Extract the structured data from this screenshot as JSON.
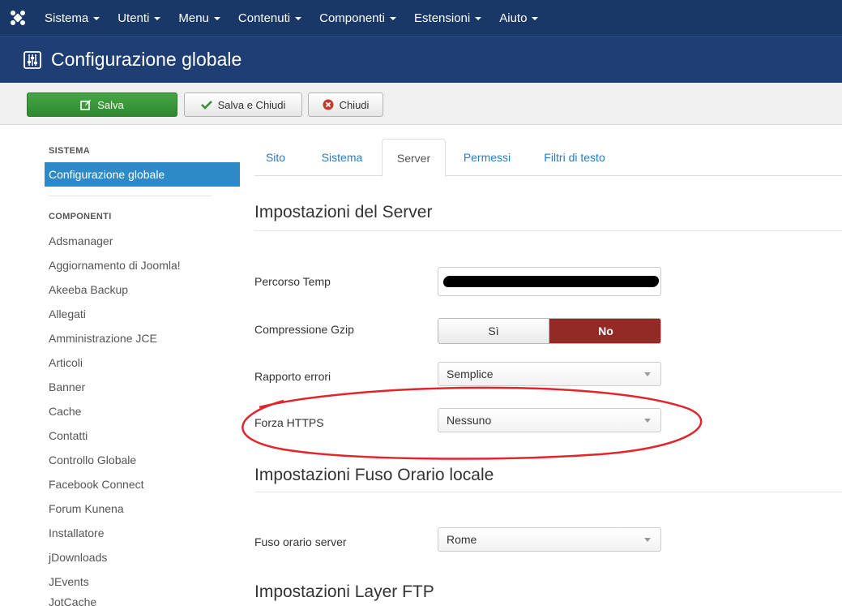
{
  "menubar": {
    "items": [
      {
        "label": "Sistema"
      },
      {
        "label": "Utenti"
      },
      {
        "label": "Menu"
      },
      {
        "label": "Contenuti"
      },
      {
        "label": "Componenti"
      },
      {
        "label": "Estensioni"
      },
      {
        "label": "Aiuto"
      }
    ]
  },
  "header": {
    "title": "Configurazione globale",
    "icon": "equalizer-icon"
  },
  "toolbar": {
    "save_label": "Salva",
    "save_close_label": "Salva e Chiudi",
    "close_label": "Chiudi"
  },
  "sidebar": {
    "system_heading": "SISTEMA",
    "active_item": "Configurazione globale",
    "components_heading": "COMPONENTI",
    "items": [
      "Adsmanager",
      "Aggiornamento di Joomla!",
      "Akeeba Backup",
      "Allegati",
      "Amministrazione JCE",
      "Articoli",
      "Banner",
      "Cache",
      "Contatti",
      "Controllo Globale",
      "Facebook Connect",
      "Forum Kunena",
      "Installatore",
      "jDownloads",
      "JEvents",
      "JotCache"
    ]
  },
  "tabs": [
    {
      "label": "Sito"
    },
    {
      "label": "Sistema"
    },
    {
      "label": "Server",
      "active": true
    },
    {
      "label": "Permessi"
    },
    {
      "label": "Filtri di testo"
    }
  ],
  "server": {
    "section_title": "Impostazioni del Server",
    "temp_path_label": "Percorso Temp",
    "gzip_label": "Compressione Gzip",
    "gzip_yes": "Sì",
    "gzip_no": "No",
    "gzip_selected": "No",
    "error_report_label": "Rapporto errori",
    "error_report_value": "Semplice",
    "force_https_label": "Forza HTTPS",
    "force_https_value": "Nessuno"
  },
  "locale": {
    "section_title": "Impostazioni Fuso Orario locale",
    "timezone_label": "Fuso orario server",
    "timezone_value": "Rome"
  },
  "ftp": {
    "section_title": "Impostazioni Layer FTP"
  },
  "colors": {
    "topbar": "#1a3867",
    "titlebar": "#1f3f74",
    "save_button": "#3f9c3f",
    "active_sidebar": "#2d8ac7",
    "toggle_no": "#942a25",
    "highlight_ellipse": "#e0262b"
  }
}
